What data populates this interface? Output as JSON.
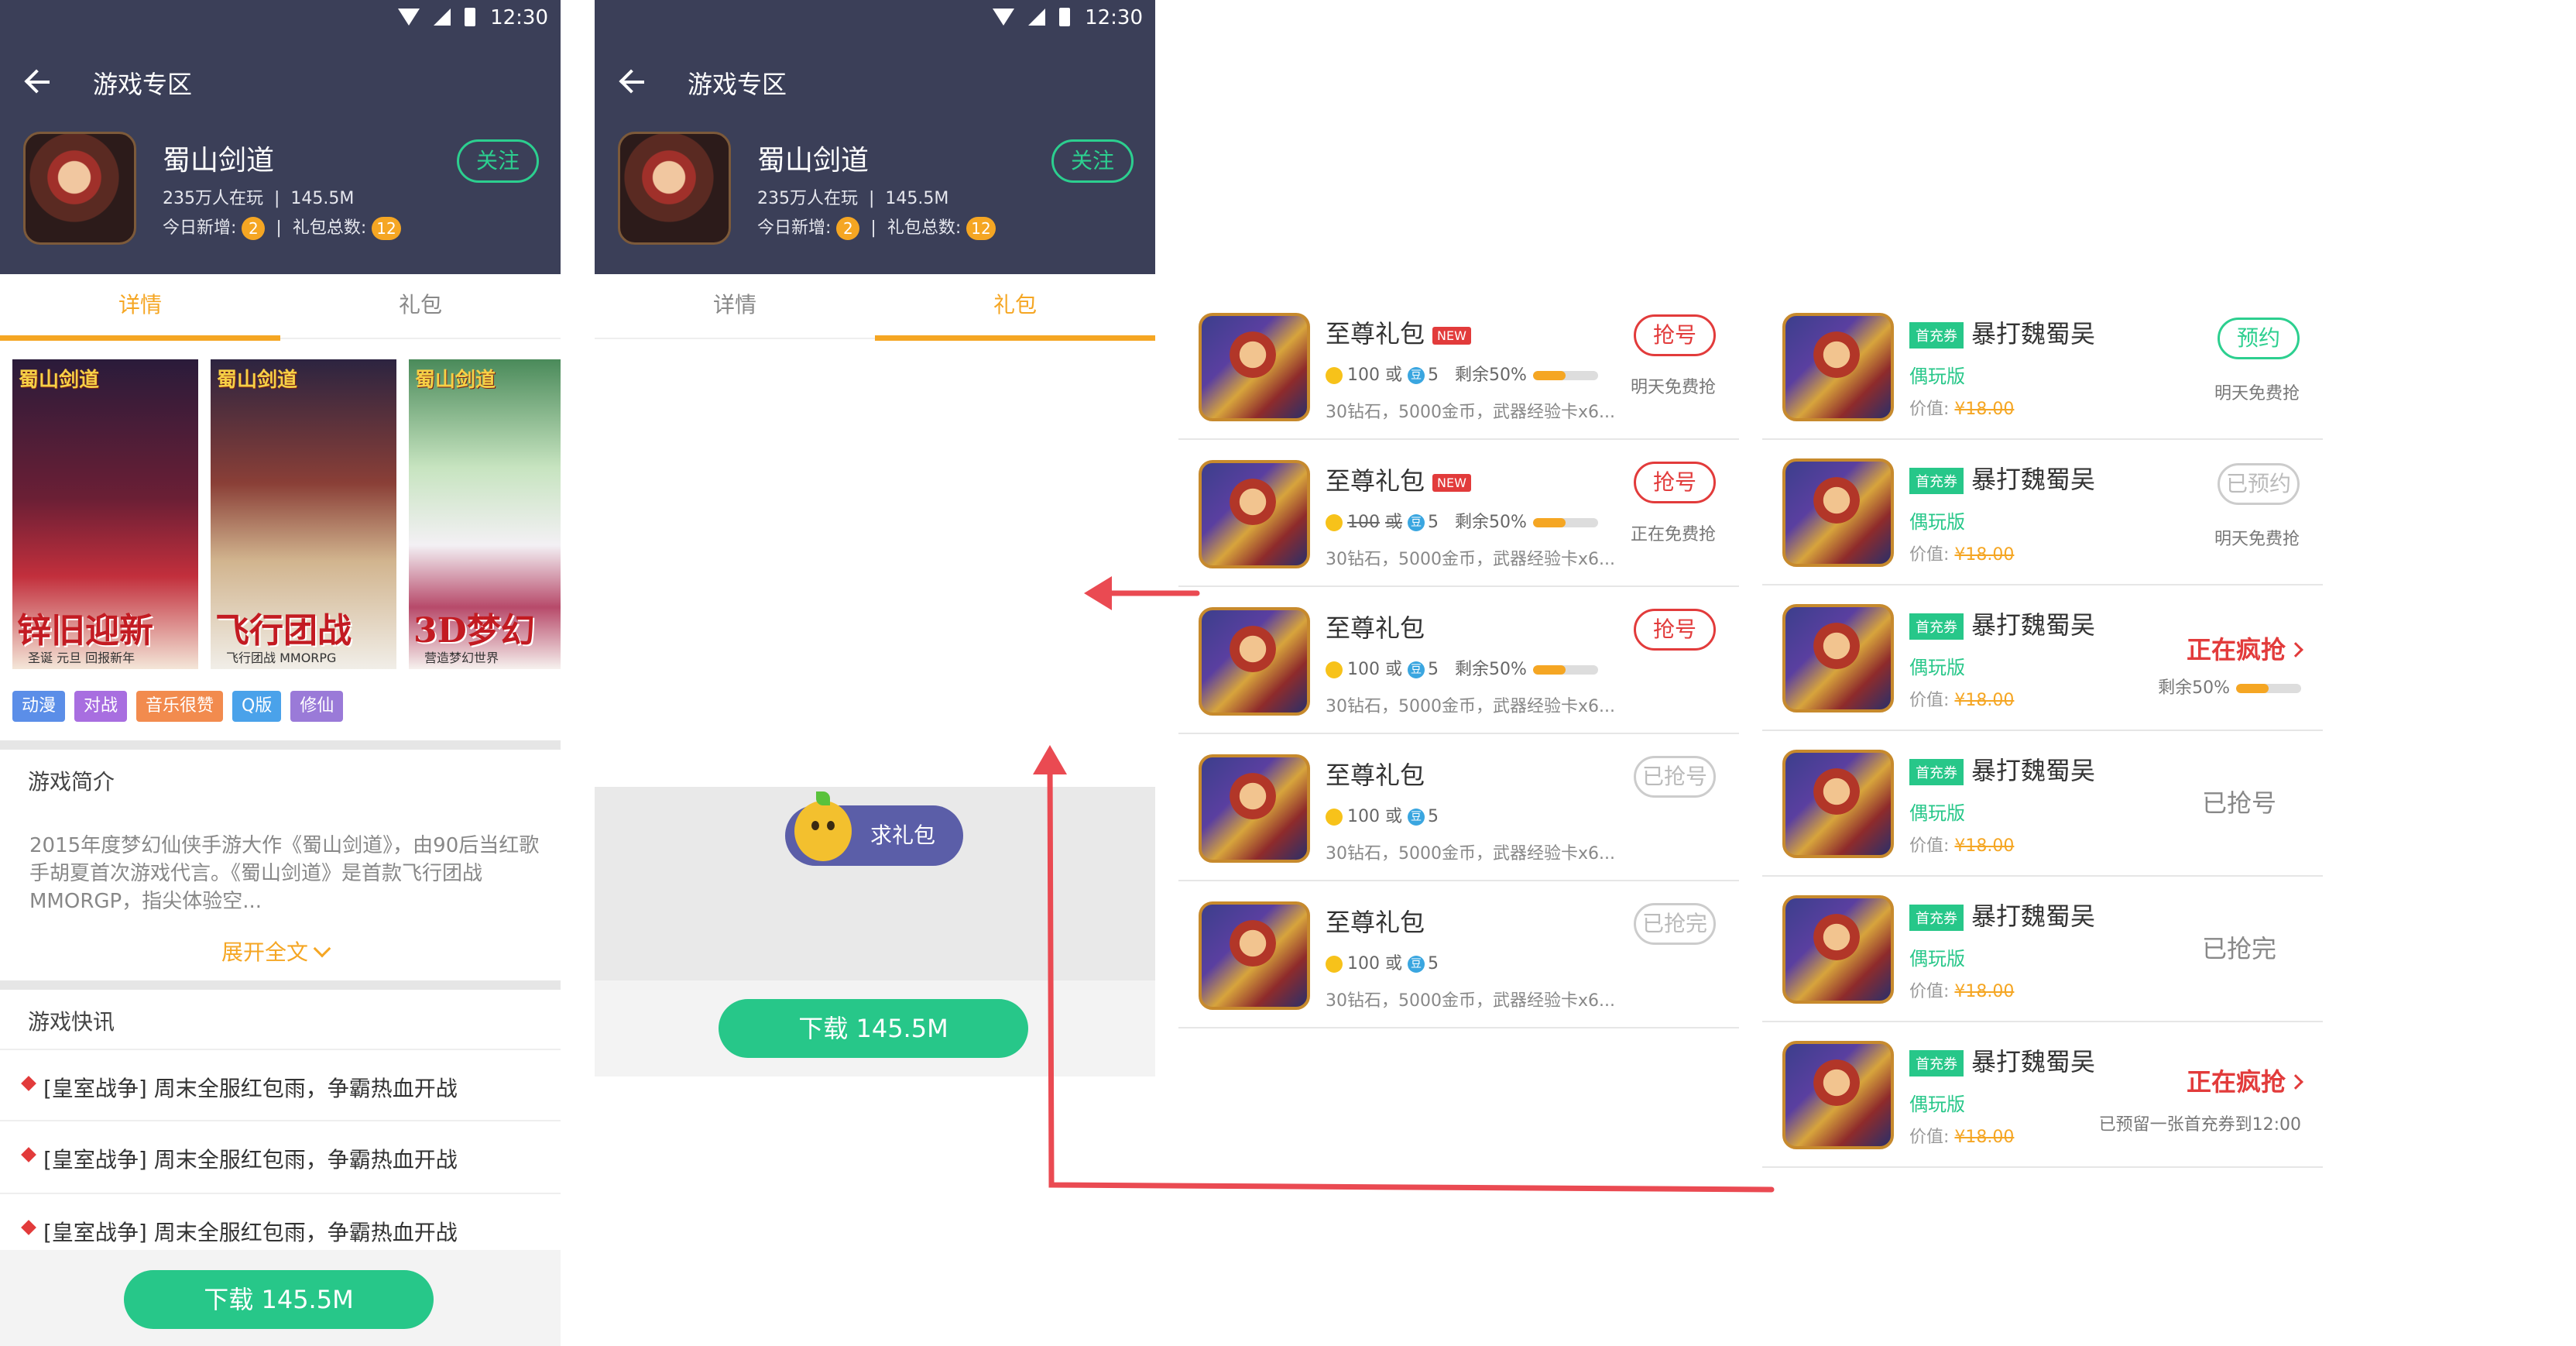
{
  "status_bar": {
    "time": "12:30"
  },
  "header": {
    "title": "游戏专区",
    "game_name": "蜀山剑道",
    "players": "235万人在玩",
    "size": "145.5M",
    "today_new_label": "今日新增:",
    "today_new": "2",
    "gift_total_label": "礼包总数:",
    "gift_total": "12",
    "follow_label": "关注"
  },
  "tabs": {
    "detail": "详情",
    "gift": "礼包"
  },
  "screenshots": [
    {
      "logo": "蜀山剑道",
      "caption": "锌旧迎新",
      "sub": "圣诞 元旦 回报新年"
    },
    {
      "logo": "蜀山剑道",
      "caption": "飞行团战",
      "sub": "飞行团战 MMORPG"
    },
    {
      "logo": "蜀山剑道",
      "caption": "3D梦幻",
      "sub": "营造梦幻世界"
    }
  ],
  "tags": [
    {
      "label": "动漫",
      "color": "#5b8ee8"
    },
    {
      "label": "对战",
      "color": "#a86ee0"
    },
    {
      "label": "音乐很赞",
      "color": "#f28b4e"
    },
    {
      "label": "Q版",
      "color": "#4aa2ea"
    },
    {
      "label": "修仙",
      "color": "#9a7ad8"
    }
  ],
  "intro": {
    "title": "游戏简介",
    "text": "2015年度梦幻仙侠手游大作《蜀山剑道》，由90后当红歌手胡夏首次游戏代言。《蜀山剑道》是首款飞行团战MMORGP，指尖体验空...",
    "expand": "展开全文"
  },
  "news": {
    "title": "游戏快讯",
    "items": [
      "[皇室战争] 周末全服红包雨，争霸热血开战",
      "[皇室战争] 周末全服红包雨，争霸热血开战",
      "[皇室战争] 周末全服红包雨，争霸热血开战"
    ]
  },
  "download_label": "下载 145.5M",
  "ask_gift": "求礼包",
  "gift_list": [
    {
      "name": "至尊礼包",
      "new": "NEW",
      "coins": "100",
      "or": "或",
      "beans": "5",
      "remain": "剩余50%",
      "remain_fraction": 0.5,
      "desc": "30钻石，5000金币，武器经验卡x6...",
      "button": "抢号",
      "button_style": "red",
      "note": "明天免费抢",
      "coins_struck": false
    },
    {
      "name": "至尊礼包",
      "new": "NEW",
      "coins": "100",
      "or": "或",
      "beans": "5",
      "remain": "剩余50%",
      "remain_fraction": 0.5,
      "desc": "30钻石，5000金币，武器经验卡x6...",
      "button": "抢号",
      "button_style": "red",
      "note": "正在免费抢",
      "coins_struck": true
    },
    {
      "name": "至尊礼包",
      "new": "",
      "coins": "100",
      "or": "或",
      "beans": "5",
      "remain": "剩余50%",
      "remain_fraction": 0.5,
      "desc": "30钻石，5000金币，武器经验卡x6...",
      "button": "抢号",
      "button_style": "red",
      "note": "",
      "coins_struck": false
    },
    {
      "name": "至尊礼包",
      "new": "",
      "coins": "100",
      "or": "或",
      "beans": "5",
      "remain": "",
      "remain_fraction": null,
      "desc": "30钻石，5000金币，武器经验卡x6...",
      "button": "已抢号",
      "button_style": "gray",
      "note": "",
      "coins_struck": false
    },
    {
      "name": "至尊礼包",
      "new": "",
      "coins": "100",
      "or": "或",
      "beans": "5",
      "remain": "",
      "remain_fraction": null,
      "desc": "30钻石，5000金币，武器经验卡x6...",
      "button": "已抢完",
      "button_style": "gray",
      "note": "",
      "coins_struck": false
    }
  ],
  "coupon_list": [
    {
      "ticket": "首充券",
      "name": "暴打魏蜀吴",
      "edition": "偶玩版",
      "price_label": "价值:",
      "price": "¥18.00",
      "action": "预约",
      "action_type": "button-green",
      "note": "明天免费抢"
    },
    {
      "ticket": "首充券",
      "name": "暴打魏蜀吴",
      "edition": "偶玩版",
      "price_label": "价值:",
      "price": "¥18.00",
      "action": "已预约",
      "action_type": "button-gray",
      "note": "明天免费抢"
    },
    {
      "ticket": "首充券",
      "name": "暴打魏蜀吴",
      "edition": "偶玩版",
      "price_label": "价值:",
      "price": "¥18.00",
      "action": "正在疯抢",
      "action_type": "hot",
      "note": "剩余50%",
      "remain_fraction": 0.5
    },
    {
      "ticket": "首充券",
      "name": "暴打魏蜀吴",
      "edition": "偶玩版",
      "price_label": "价值:",
      "price": "¥18.00",
      "action": "已抢号",
      "action_type": "text",
      "note": ""
    },
    {
      "ticket": "首充券",
      "name": "暴打魏蜀吴",
      "edition": "偶玩版",
      "price_label": "价值:",
      "price": "¥18.00",
      "action": "已抢完",
      "action_type": "text",
      "note": ""
    },
    {
      "ticket": "首充券",
      "name": "暴打魏蜀吴",
      "edition": "偶玩版",
      "price_label": "价值:",
      "price": "¥18.00",
      "action": "正在疯抢",
      "action_type": "hot",
      "note": "已预留一张首充券到12:00"
    }
  ],
  "colors": {
    "header_bg": "#3b3f58",
    "accent_orange": "#f5a623",
    "accent_green": "#27c789",
    "accent_red": "#e23b3b",
    "arrow": "#ea4a52"
  }
}
